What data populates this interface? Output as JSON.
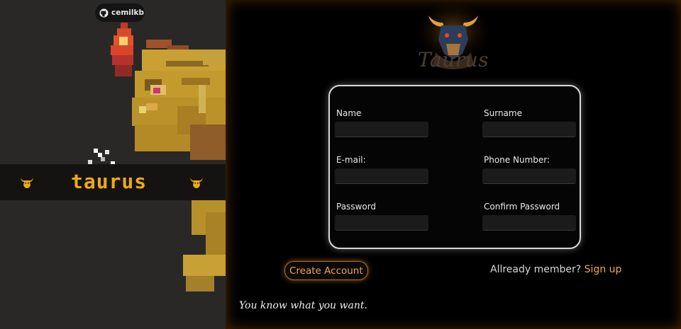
{
  "github_badge": {
    "icon": "github-icon",
    "label": "cemilkb"
  },
  "left_band": {
    "title": "taurus",
    "icon": "bull-head-icon"
  },
  "logo": {
    "icon": "bull-logo-icon",
    "text": "Taurus"
  },
  "form": {
    "fields": [
      {
        "label": "Name",
        "value": "",
        "placeholder": ""
      },
      {
        "label": "Surname",
        "value": "",
        "placeholder": ""
      },
      {
        "label": "E-mail:",
        "value": "",
        "placeholder": ""
      },
      {
        "label": "Phone Number:",
        "value": "",
        "placeholder": ""
      },
      {
        "label": "Password",
        "value": "",
        "placeholder": ""
      },
      {
        "label": "Confirm Password",
        "value": "",
        "placeholder": ""
      }
    ]
  },
  "actions": {
    "create_account": "Create Account",
    "already_member": "Allready member?",
    "sign_up": "Sign up"
  },
  "motto": "You know what you want.",
  "colors": {
    "accent": "#f0a548",
    "band_title": "#f2a90f",
    "left_background": "#2a2826",
    "right_background": "#000000"
  }
}
